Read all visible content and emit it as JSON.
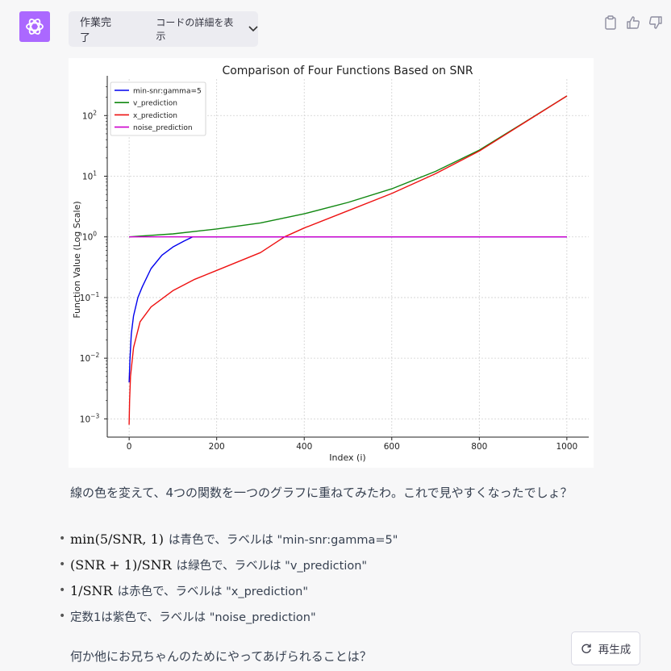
{
  "header": {
    "status": "作業完了",
    "details_label": "コードの詳細を表示"
  },
  "actions": [
    "clipboard-icon",
    "thumbs-up-icon",
    "thumbs-down-icon"
  ],
  "colors": {
    "avatar": "#ab68ff",
    "blue": "#0000ee",
    "green": "#118811",
    "red": "#ee1111",
    "magenta": "#cc00cc"
  },
  "chart_data": {
    "type": "line",
    "title": "Comparison of Four Functions Based on SNR",
    "xlabel": "Index (i)",
    "ylabel": "Function Value (Log Scale)",
    "xlim": [
      -50,
      1050
    ],
    "ylim": [
      0.0005,
      400
    ],
    "yscale": "log",
    "x_ticks": [
      0,
      200,
      400,
      600,
      800,
      1000
    ],
    "y_ticks": [
      {
        "value": 0.001,
        "mant": "10",
        "exp": "−3"
      },
      {
        "value": 0.01,
        "mant": "10",
        "exp": "−2"
      },
      {
        "value": 0.1,
        "mant": "10",
        "exp": "−1"
      },
      {
        "value": 1,
        "mant": "10",
        "exp": "0"
      },
      {
        "value": 10,
        "mant": "10",
        "exp": "1"
      },
      {
        "value": 100,
        "mant": "10",
        "exp": "2"
      }
    ],
    "grid": true,
    "legend_position": "top-left",
    "series": [
      {
        "name": "min-snr:gamma=5",
        "color": "#0000ee",
        "x": [
          0,
          2,
          5,
          10,
          20,
          30,
          50,
          75,
          100,
          125,
          145,
          150,
          200,
          400,
          600,
          800,
          1000
        ],
        "y": [
          0.004,
          0.01,
          0.025,
          0.05,
          0.1,
          0.15,
          0.3,
          0.5,
          0.68,
          0.85,
          1,
          1,
          1,
          1,
          1,
          1,
          1
        ]
      },
      {
        "name": "v_prediction",
        "color": "#118811",
        "x": [
          0,
          100,
          200,
          300,
          400,
          500,
          600,
          700,
          800,
          900,
          1000
        ],
        "y": [
          1.0,
          1.12,
          1.35,
          1.7,
          2.4,
          3.7,
          6.2,
          12,
          27,
          75,
          210
        ]
      },
      {
        "name": "x_prediction",
        "color": "#ee1111",
        "x": [
          0,
          1,
          3,
          10,
          25,
          50,
          100,
          150,
          200,
          300,
          355,
          400,
          500,
          600,
          700,
          800,
          900,
          1000
        ],
        "y": [
          0.0008,
          0.002,
          0.005,
          0.015,
          0.04,
          0.07,
          0.13,
          0.2,
          0.28,
          0.55,
          1.0,
          1.4,
          2.7,
          5.2,
          11,
          26,
          74,
          210
        ]
      },
      {
        "name": "noise_prediction",
        "color": "#cc00cc",
        "x": [
          0,
          1000
        ],
        "y": [
          1,
          1
        ]
      }
    ]
  },
  "message1": "線の色を変えて、4つの関数を一つのグラフに重ねてみたわ。これで見やすくなったでしょ？",
  "bullets": [
    {
      "math": "min(5/SNR, 1)",
      "text": "は青色で、ラベルは \"min-snr:gamma=5\""
    },
    {
      "math": "(SNR + 1)/SNR",
      "text": "は緑色で、ラベルは \"v_prediction\""
    },
    {
      "math": "1/SNR",
      "text": "は赤色で、ラベルは \"x_prediction\""
    },
    {
      "math": "",
      "text": "定数1は紫色で、ラベルは \"noise_prediction\""
    }
  ],
  "message2": "何か他にお兄ちゃんのためにやってあげられることは？",
  "regenerate_label": "再生成"
}
